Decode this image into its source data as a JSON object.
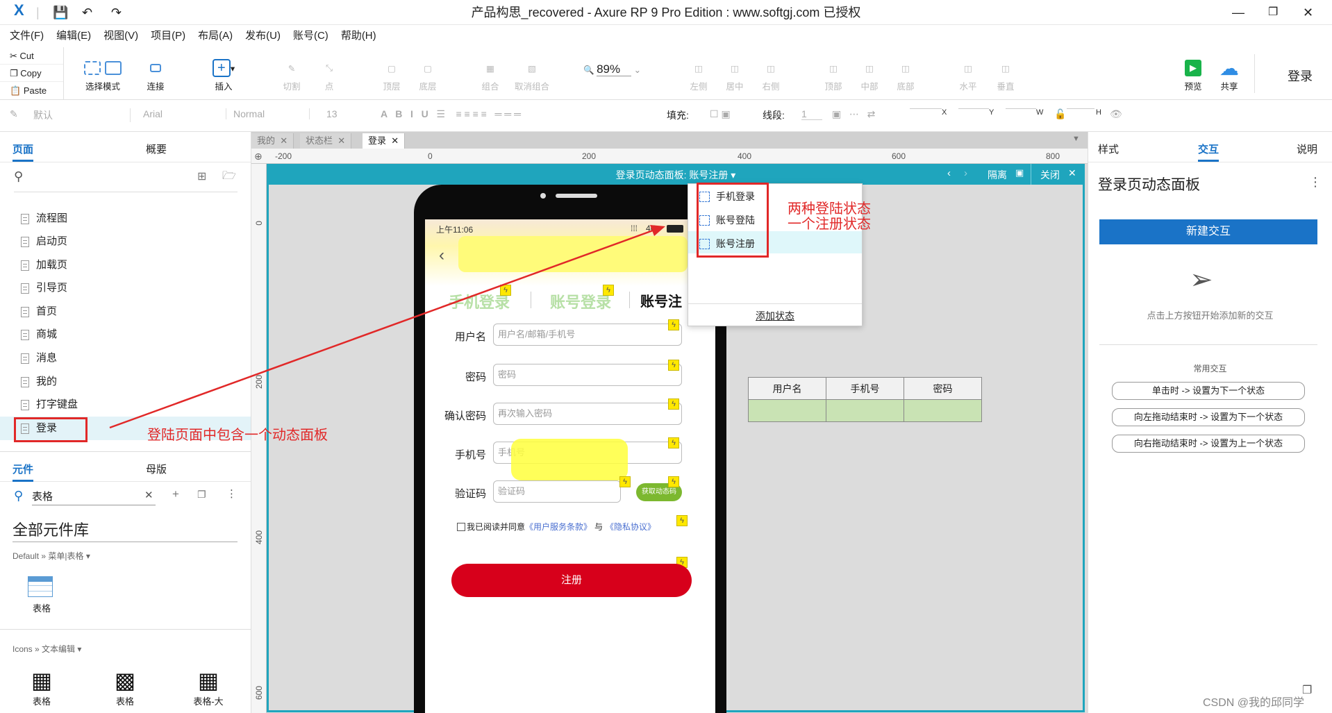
{
  "window": {
    "title": "产品构思_recovered - Axure RP 9 Pro Edition : www.softgj.com 已授权"
  },
  "menu": [
    "文件(F)",
    "编辑(E)",
    "视图(V)",
    "项目(P)",
    "布局(A)",
    "发布(U)",
    "账号(C)",
    "帮助(H)"
  ],
  "clipboard": {
    "cut": "Cut",
    "copy": "Copy",
    "paste": "Paste"
  },
  "toolbar": {
    "select": "选择模式",
    "connect": "连接",
    "insert": "插入",
    "cut": "切割",
    "point": "点",
    "top": "顶层",
    "bottom": "底层",
    "group": "组合",
    "ungroup": "取消组合",
    "zoom": "89%",
    "left": "左侧",
    "center": "居中",
    "right": "右侧",
    "atop": "顶部",
    "amid": "中部",
    "abottom": "底部",
    "horiz": "水平",
    "vert": "垂直",
    "preview": "预览",
    "share": "共享",
    "login": "登录"
  },
  "stylebar": {
    "style": "默认",
    "font": "Arial",
    "weight": "Normal",
    "size": "13",
    "fill": "填充:",
    "line": "线段:",
    "line_val": "1",
    "x": "X",
    "y": "Y",
    "w": "W",
    "h": "H"
  },
  "left": {
    "tab_pages": "页面",
    "tab_overview": "概要",
    "pages": [
      "流程图",
      "启动页",
      "加载页",
      "引导页",
      "首页",
      "商城",
      "消息",
      "我的",
      "打字键盘",
      "登录"
    ],
    "tab_widgets": "元件",
    "tab_masters": "母版",
    "search_value": "表格",
    "library": "全部元件库",
    "lib_path": "Default » 菜单|表格 ▾",
    "widget_table": "表格",
    "icons_path": "Icons » 文本编辑 ▾",
    "icons": [
      "表格",
      "表格",
      "表格-大"
    ]
  },
  "canvas": {
    "tabs": [
      "我的",
      "状态栏",
      "登录"
    ],
    "ruler_h": [
      "-200",
      "0",
      "200",
      "400",
      "600",
      "800"
    ],
    "ruler_v": [
      "0",
      "200",
      "400",
      "600"
    ],
    "dp_title": "登录页动态面板: 账号注册 ▾",
    "isolate": "隔离",
    "close": "关闭",
    "states": [
      "手机登录",
      "账号登陆",
      "账号注册"
    ],
    "add_state": "添加状态",
    "annot_right_1": "两种登陆状态",
    "annot_right_2": "一个注册状态",
    "annot_left": "登陆页面中包含一个动态面板",
    "phone": {
      "time": "上午11:06",
      "net": "4G",
      "tabs": [
        "手机登录",
        "账号登录",
        "账号注"
      ],
      "fields": [
        {
          "label": "用户名",
          "placeholder": "用户名/邮箱/手机号"
        },
        {
          "label": "密码",
          "placeholder": "密码"
        },
        {
          "label": "确认密码",
          "placeholder": "再次输入密码"
        },
        {
          "label": "手机号",
          "placeholder": "手机号"
        },
        {
          "label": "验证码",
          "placeholder": "验证码"
        }
      ],
      "get_code": "获取动态码",
      "agree": "我已阅读并同意",
      "terms": "《用户服务条款》",
      "and": "与",
      "privacy": "《隐私协议》",
      "register": "注册"
    },
    "table_headers": [
      "用户名",
      "手机号",
      "密码"
    ]
  },
  "right": {
    "tabs": [
      "样式",
      "交互",
      "说明"
    ],
    "panel_title": "登录页动态面板",
    "new_interaction": "新建交互",
    "hint": "点击上方按钮开始添加新的交互",
    "common": "常用交互",
    "actions": [
      "单击时 -> 设置为下一个状态",
      "向左拖动结束时 -> 设置为下一个状态",
      "向右拖动结束时 -> 设置为上一个状态"
    ]
  },
  "watermark": "CSDN @我的邱同学",
  "colors": {
    "accent": "#1a73c7",
    "panel": "#1fa5bd",
    "annotation": "#e12828",
    "register": "#d7001b"
  }
}
